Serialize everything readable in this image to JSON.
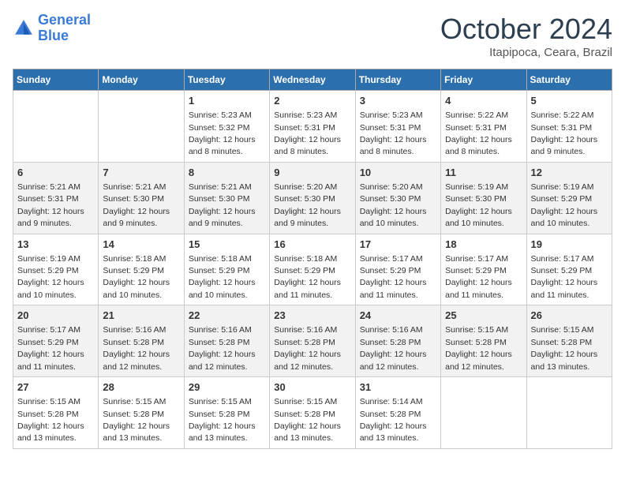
{
  "logo": {
    "line1": "General",
    "line2": "Blue"
  },
  "title": "October 2024",
  "location": "Itapipoca, Ceara, Brazil",
  "weekdays": [
    "Sunday",
    "Monday",
    "Tuesday",
    "Wednesday",
    "Thursday",
    "Friday",
    "Saturday"
  ],
  "weeks": [
    [
      {
        "day": "",
        "sunrise": "",
        "sunset": "",
        "daylight": ""
      },
      {
        "day": "",
        "sunrise": "",
        "sunset": "",
        "daylight": ""
      },
      {
        "day": "1",
        "sunrise": "Sunrise: 5:23 AM",
        "sunset": "Sunset: 5:32 PM",
        "daylight": "Daylight: 12 hours and 8 minutes."
      },
      {
        "day": "2",
        "sunrise": "Sunrise: 5:23 AM",
        "sunset": "Sunset: 5:31 PM",
        "daylight": "Daylight: 12 hours and 8 minutes."
      },
      {
        "day": "3",
        "sunrise": "Sunrise: 5:23 AM",
        "sunset": "Sunset: 5:31 PM",
        "daylight": "Daylight: 12 hours and 8 minutes."
      },
      {
        "day": "4",
        "sunrise": "Sunrise: 5:22 AM",
        "sunset": "Sunset: 5:31 PM",
        "daylight": "Daylight: 12 hours and 8 minutes."
      },
      {
        "day": "5",
        "sunrise": "Sunrise: 5:22 AM",
        "sunset": "Sunset: 5:31 PM",
        "daylight": "Daylight: 12 hours and 9 minutes."
      }
    ],
    [
      {
        "day": "6",
        "sunrise": "Sunrise: 5:21 AM",
        "sunset": "Sunset: 5:31 PM",
        "daylight": "Daylight: 12 hours and 9 minutes."
      },
      {
        "day": "7",
        "sunrise": "Sunrise: 5:21 AM",
        "sunset": "Sunset: 5:30 PM",
        "daylight": "Daylight: 12 hours and 9 minutes."
      },
      {
        "day": "8",
        "sunrise": "Sunrise: 5:21 AM",
        "sunset": "Sunset: 5:30 PM",
        "daylight": "Daylight: 12 hours and 9 minutes."
      },
      {
        "day": "9",
        "sunrise": "Sunrise: 5:20 AM",
        "sunset": "Sunset: 5:30 PM",
        "daylight": "Daylight: 12 hours and 9 minutes."
      },
      {
        "day": "10",
        "sunrise": "Sunrise: 5:20 AM",
        "sunset": "Sunset: 5:30 PM",
        "daylight": "Daylight: 12 hours and 10 minutes."
      },
      {
        "day": "11",
        "sunrise": "Sunrise: 5:19 AM",
        "sunset": "Sunset: 5:30 PM",
        "daylight": "Daylight: 12 hours and 10 minutes."
      },
      {
        "day": "12",
        "sunrise": "Sunrise: 5:19 AM",
        "sunset": "Sunset: 5:29 PM",
        "daylight": "Daylight: 12 hours and 10 minutes."
      }
    ],
    [
      {
        "day": "13",
        "sunrise": "Sunrise: 5:19 AM",
        "sunset": "Sunset: 5:29 PM",
        "daylight": "Daylight: 12 hours and 10 minutes."
      },
      {
        "day": "14",
        "sunrise": "Sunrise: 5:18 AM",
        "sunset": "Sunset: 5:29 PM",
        "daylight": "Daylight: 12 hours and 10 minutes."
      },
      {
        "day": "15",
        "sunrise": "Sunrise: 5:18 AM",
        "sunset": "Sunset: 5:29 PM",
        "daylight": "Daylight: 12 hours and 10 minutes."
      },
      {
        "day": "16",
        "sunrise": "Sunrise: 5:18 AM",
        "sunset": "Sunset: 5:29 PM",
        "daylight": "Daylight: 12 hours and 11 minutes."
      },
      {
        "day": "17",
        "sunrise": "Sunrise: 5:17 AM",
        "sunset": "Sunset: 5:29 PM",
        "daylight": "Daylight: 12 hours and 11 minutes."
      },
      {
        "day": "18",
        "sunrise": "Sunrise: 5:17 AM",
        "sunset": "Sunset: 5:29 PM",
        "daylight": "Daylight: 12 hours and 11 minutes."
      },
      {
        "day": "19",
        "sunrise": "Sunrise: 5:17 AM",
        "sunset": "Sunset: 5:29 PM",
        "daylight": "Daylight: 12 hours and 11 minutes."
      }
    ],
    [
      {
        "day": "20",
        "sunrise": "Sunrise: 5:17 AM",
        "sunset": "Sunset: 5:29 PM",
        "daylight": "Daylight: 12 hours and 11 minutes."
      },
      {
        "day": "21",
        "sunrise": "Sunrise: 5:16 AM",
        "sunset": "Sunset: 5:28 PM",
        "daylight": "Daylight: 12 hours and 12 minutes."
      },
      {
        "day": "22",
        "sunrise": "Sunrise: 5:16 AM",
        "sunset": "Sunset: 5:28 PM",
        "daylight": "Daylight: 12 hours and 12 minutes."
      },
      {
        "day": "23",
        "sunrise": "Sunrise: 5:16 AM",
        "sunset": "Sunset: 5:28 PM",
        "daylight": "Daylight: 12 hours and 12 minutes."
      },
      {
        "day": "24",
        "sunrise": "Sunrise: 5:16 AM",
        "sunset": "Sunset: 5:28 PM",
        "daylight": "Daylight: 12 hours and 12 minutes."
      },
      {
        "day": "25",
        "sunrise": "Sunrise: 5:15 AM",
        "sunset": "Sunset: 5:28 PM",
        "daylight": "Daylight: 12 hours and 12 minutes."
      },
      {
        "day": "26",
        "sunrise": "Sunrise: 5:15 AM",
        "sunset": "Sunset: 5:28 PM",
        "daylight": "Daylight: 12 hours and 13 minutes."
      }
    ],
    [
      {
        "day": "27",
        "sunrise": "Sunrise: 5:15 AM",
        "sunset": "Sunset: 5:28 PM",
        "daylight": "Daylight: 12 hours and 13 minutes."
      },
      {
        "day": "28",
        "sunrise": "Sunrise: 5:15 AM",
        "sunset": "Sunset: 5:28 PM",
        "daylight": "Daylight: 12 hours and 13 minutes."
      },
      {
        "day": "29",
        "sunrise": "Sunrise: 5:15 AM",
        "sunset": "Sunset: 5:28 PM",
        "daylight": "Daylight: 12 hours and 13 minutes."
      },
      {
        "day": "30",
        "sunrise": "Sunrise: 5:15 AM",
        "sunset": "Sunset: 5:28 PM",
        "daylight": "Daylight: 12 hours and 13 minutes."
      },
      {
        "day": "31",
        "sunrise": "Sunrise: 5:14 AM",
        "sunset": "Sunset: 5:28 PM",
        "daylight": "Daylight: 12 hours and 13 minutes."
      },
      {
        "day": "",
        "sunrise": "",
        "sunset": "",
        "daylight": ""
      },
      {
        "day": "",
        "sunrise": "",
        "sunset": "",
        "daylight": ""
      }
    ]
  ]
}
